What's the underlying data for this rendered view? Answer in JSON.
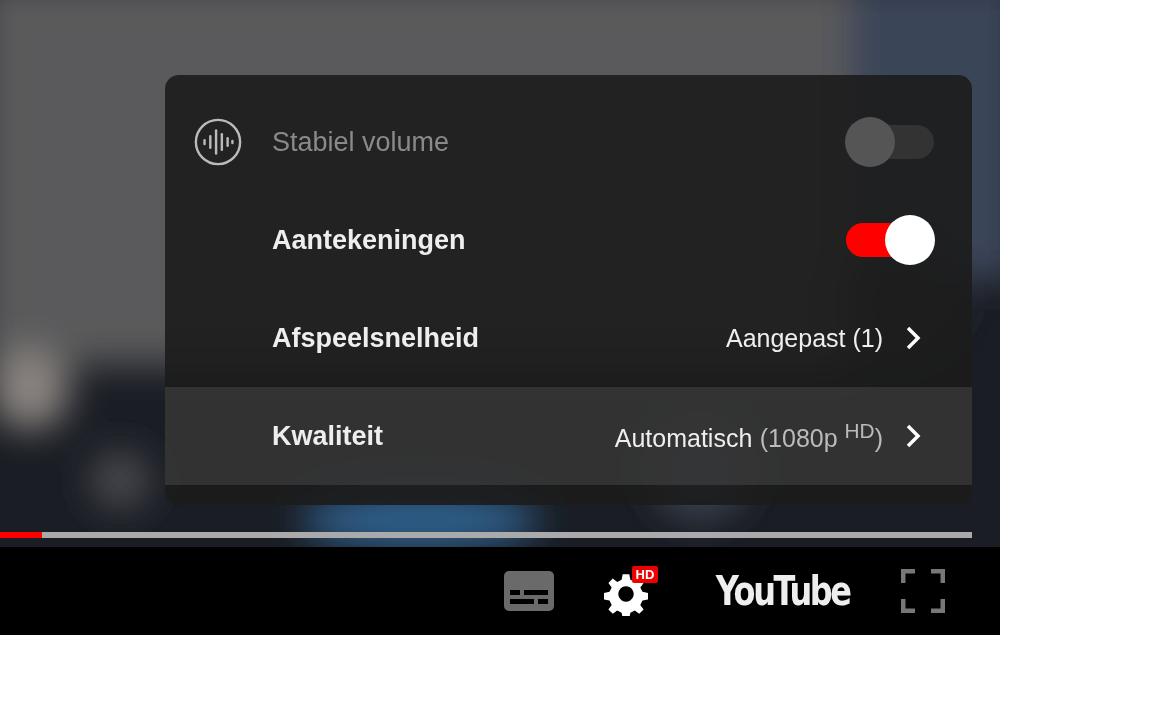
{
  "settings_menu": {
    "items": [
      {
        "kind": "toggle",
        "label": "Stabiel volume",
        "has_icon": true,
        "disabled": true,
        "on": false,
        "selected": false
      },
      {
        "kind": "toggle",
        "label": "Aantekeningen",
        "has_icon": false,
        "disabled": false,
        "on": true,
        "selected": false
      },
      {
        "kind": "submenu",
        "label": "Afspeelsnelheid",
        "value": "Aangepast (1)",
        "selected": false
      },
      {
        "kind": "submenu",
        "label": "Kwaliteit",
        "value": "Automatisch",
        "value_detail": "(1080p $^{HD}$)",
        "selected": true
      }
    ]
  },
  "progress": {
    "level": 0.043
  },
  "controls": {
    "settings_badge": "HD",
    "logo": "YouTube"
  }
}
